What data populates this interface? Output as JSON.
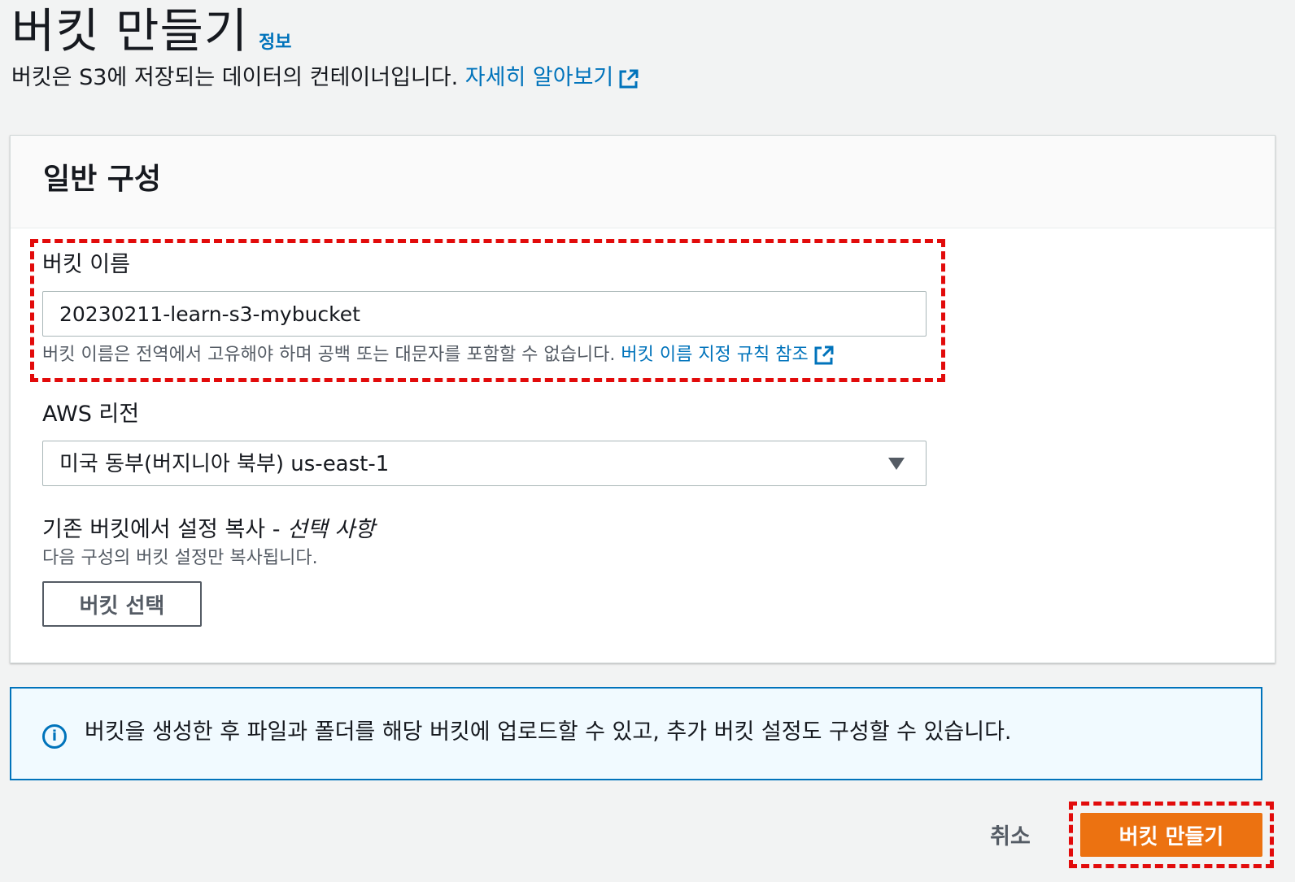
{
  "header": {
    "title": "버킷 만들기",
    "info_link": "정보",
    "description": "버킷은 S3에 저장되는 데이터의 컨테이너입니다. ",
    "learn_more_link": "자세히 알아보기"
  },
  "general_config": {
    "title": "일반 구성",
    "bucket_name": {
      "label": "버킷 이름",
      "value": "20230211-learn-s3-mybucket",
      "hint": "버킷 이름은 전역에서 고유해야 하며 공백 또는 대문자를 포함할 수 없습니다. ",
      "hint_link": "버킷 이름 지정 규칙 참조"
    },
    "region": {
      "label": "AWS 리전",
      "selected": "미국 동부(버지니아 북부) us-east-1"
    },
    "copy_settings": {
      "label": "기존 버킷에서 설정 복사 - ",
      "optional": "선택 사항",
      "hint": "다음 구성의 버킷 설정만 복사됩니다.",
      "button": "버킷 선택"
    }
  },
  "info_alert": {
    "icon": "info-icon",
    "text": "버킷을 생성한 후 파일과 폴더를 해당 버킷에 업로드할 수 있고, 추가 버킷 설정도 구성할 수 있습니다."
  },
  "footer": {
    "cancel": "취소",
    "create": "버킷 만들기"
  },
  "colors": {
    "primary_button": "#ec7211",
    "link": "#0073bb",
    "highlight": "#e20b0b"
  }
}
